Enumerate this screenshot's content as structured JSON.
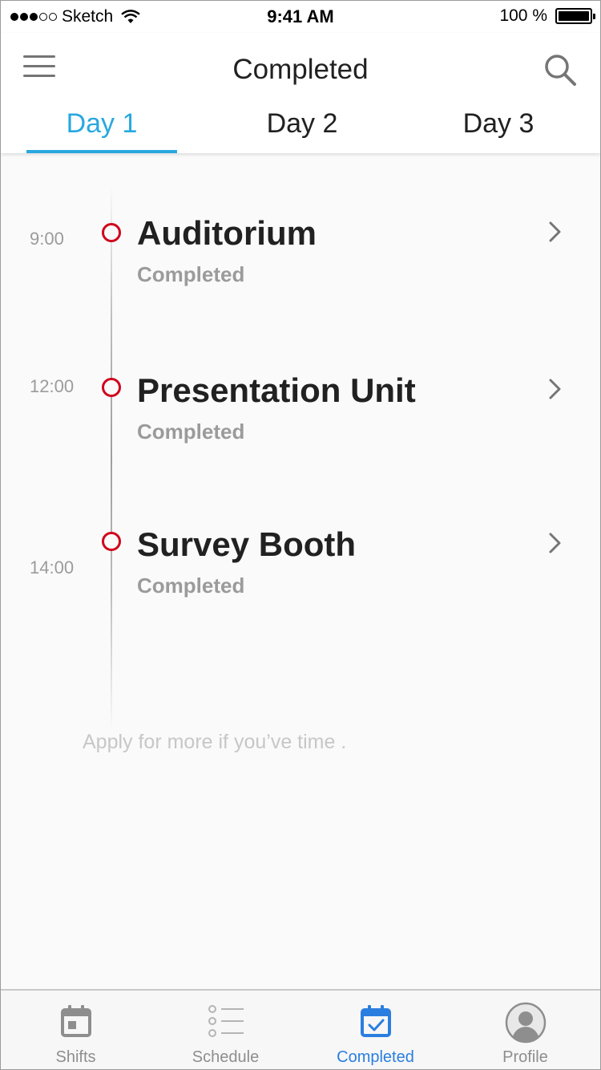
{
  "status_bar": {
    "carrier": "Sketch",
    "time": "9:41 AM",
    "battery": "100 %"
  },
  "header": {
    "title": "Completed",
    "menu_icon": "menu-icon",
    "search_icon": "search-icon"
  },
  "tabs": [
    {
      "label": "Day 1",
      "active": true
    },
    {
      "label": "Day 2",
      "active": false
    },
    {
      "label": "Day 3",
      "active": false
    }
  ],
  "timeline": {
    "items": [
      {
        "time": "9:00",
        "title": "Auditorium",
        "status": "Completed"
      },
      {
        "time": "12:00",
        "title": "Presentation Unit",
        "status": "Completed"
      },
      {
        "time": "14:00",
        "title": "Survey Booth",
        "status": "Completed"
      }
    ],
    "dot_color": "#d0021b",
    "footer": "Apply for more if you’ve time ."
  },
  "tab_bar": {
    "items": [
      {
        "label": "Shifts",
        "icon": "calendar-icon",
        "active": false
      },
      {
        "label": "Schedule",
        "icon": "list-icon",
        "active": false
      },
      {
        "label": "Completed",
        "icon": "calendar-check-icon",
        "active": true
      },
      {
        "label": "Profile",
        "icon": "profile-icon",
        "active": false
      }
    ]
  },
  "colors": {
    "accent": "#29a8e0",
    "tab_active": "#2a7ee0",
    "dot": "#d0021b"
  }
}
